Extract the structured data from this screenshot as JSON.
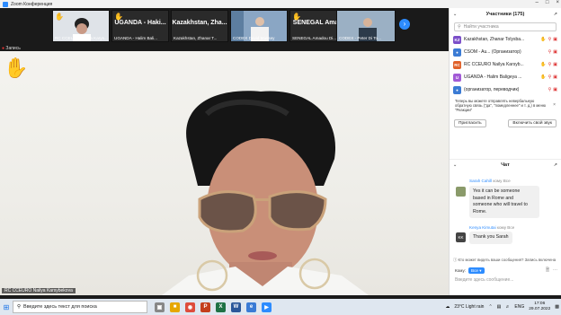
{
  "window": {
    "title": "Zoom Конференция"
  },
  "thumbnails": [
    {
      "label": "RC CCEURO Nailya Karys...",
      "name": "",
      "hand": true,
      "bg": "#dfe3e8"
    },
    {
      "label": "UGANDA - Halim Bali...",
      "name": "UGANDA - Haki...",
      "hand": true,
      "bg": "#2a2a2a"
    },
    {
      "label": "Kazakhstan, Zhanar T...",
      "name": "Kazakhstan, Zha...",
      "hand": false,
      "bg": "#2a2a2a"
    },
    {
      "label": "CODEX David Massey",
      "name": "",
      "hand": false,
      "bg": "#6a8fb5"
    },
    {
      "label": "SENEGAL Amadou Di...",
      "name": "SENEGAL Ama...",
      "hand": true,
      "bg": "#2a2a2a"
    },
    {
      "label": "CODEX - Peter Di To...",
      "name": "",
      "hand": false,
      "bg": "#7c95ad"
    }
  ],
  "view_label": "Запись",
  "main_speaker": {
    "label": "RC CCEURO Nailya Karsybekova"
  },
  "participants": {
    "title": "Участники (175)",
    "search_placeholder": "Найти участника",
    "rows": [
      {
        "initials": "KZ",
        "color": "#7b4fc9",
        "name": "Kazakhstan, Zhanar Tolysba..."
      },
      {
        "initials": "",
        "color": "#3b7bd4",
        "name": "CSOM - Au... (Организатор)"
      },
      {
        "initials": "RC",
        "color": "#e0622b",
        "name": "RC CCEURO Nailya Karsyb..."
      },
      {
        "initials": "U",
        "color": "#a25bd6",
        "name": "UGANDA - Halim Baligeya ..."
      },
      {
        "initials": "",
        "color": "#3b7bd4",
        "name": "(организатор, переводчик)"
      }
    ],
    "tooltip": "Теперь вы можете отправлять невербальную обратную связь (\"да\", \"помедленнее\" и т. д.) в меню \"Реакции\"",
    "invite_label": "Пригласить",
    "unmute_label": "Включить свой звук"
  },
  "chat": {
    "title": "Чат",
    "messages": [
      {
        "sender": "Sarah Cahill",
        "to": "кому Все",
        "text": [
          "Yes it can be someone",
          "based in Rome and",
          "someone who will travel to",
          "Rome."
        ]
      },
      {
        "sender": "Kenya Kimutai",
        "to": "кому Все",
        "text": [
          "Thank you Sarah"
        ],
        "initials": "KK"
      }
    ],
    "note": "Кто может видеть ваши сообщения? Запись включена",
    "to_label": "Кому:",
    "to_value": "Все",
    "input_placeholder": "Введите здесь сообщение..."
  },
  "taskbar": {
    "search_placeholder": "Введите здесь текст для поиска",
    "weather": "23°C  Light rain",
    "lang": "ENG",
    "time": "17:06",
    "date": "29.07.2022"
  }
}
